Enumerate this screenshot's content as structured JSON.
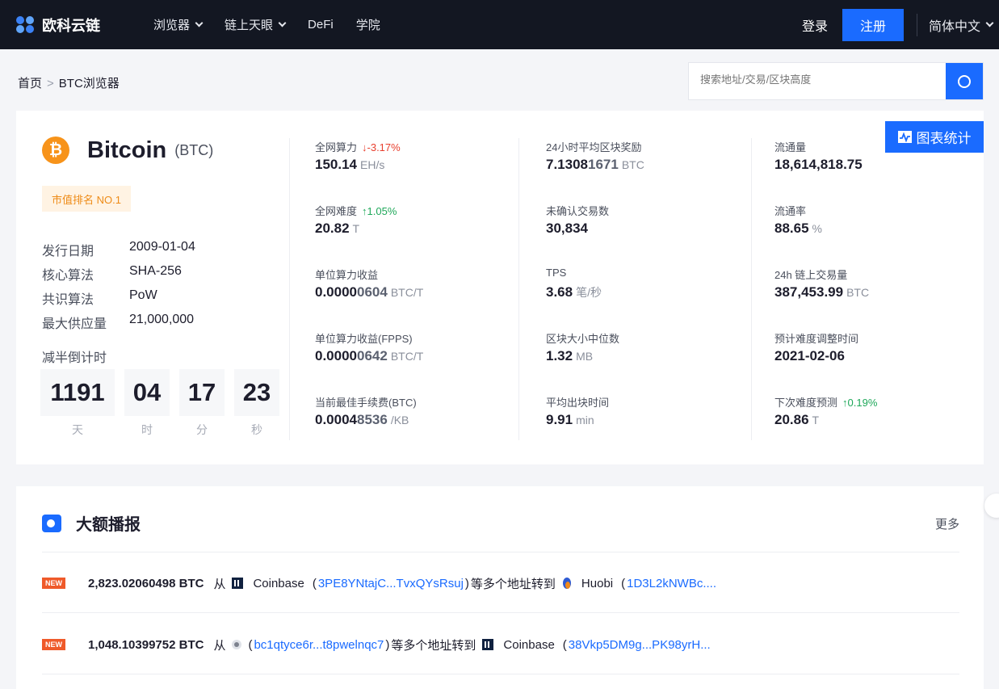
{
  "nav": {
    "logo": "欧科云链",
    "items": [
      {
        "label": "浏览器",
        "dropdown": true
      },
      {
        "label": "链上天眼",
        "dropdown": true
      },
      {
        "label": "DeFi",
        "dropdown": false
      },
      {
        "label": "学院",
        "dropdown": false
      }
    ],
    "login": "登录",
    "register": "注册",
    "language": "简体中文"
  },
  "breadcrumb": {
    "home": "首页",
    "sep": ">",
    "current": "BTC浏览器"
  },
  "search": {
    "placeholder": "搜索地址/交易/区块高度"
  },
  "coin": {
    "name": "Bitcoin",
    "symbol": "(BTC)",
    "rank": "市值排名 NO.1",
    "info": [
      {
        "label": "发行日期",
        "value": "2009-01-04"
      },
      {
        "label": "核心算法",
        "value": "SHA-256"
      },
      {
        "label": "共识算法",
        "value": "PoW"
      },
      {
        "label": "最大供应量",
        "value": "21,000,000"
      }
    ],
    "halving_label": "减半倒计时",
    "countdown": [
      {
        "value": "1191",
        "unit": "天"
      },
      {
        "value": "04",
        "unit": "时"
      },
      {
        "value": "17",
        "unit": "分"
      },
      {
        "value": "23",
        "unit": "秒"
      }
    ]
  },
  "chart_button": "图表统计",
  "stats": {
    "col1": [
      {
        "label": "全网算力",
        "change": "↓-3.17%",
        "dir": "down",
        "value_main": "150.14",
        "value_soft": "",
        "unit": "EH/s"
      },
      {
        "label": "全网难度",
        "change": "↑1.05%",
        "dir": "up",
        "value_main": "20.82",
        "value_soft": "",
        "unit": "T"
      },
      {
        "label": "单位算力收益",
        "change": "",
        "dir": "",
        "value_main": "0.0000",
        "value_soft": "0604",
        "unit": "BTC/T"
      },
      {
        "label": "单位算力收益(FPPS)",
        "change": "",
        "dir": "",
        "value_main": "0.0000",
        "value_soft": "0642",
        "unit": "BTC/T"
      },
      {
        "label": "当前最佳手续费(BTC)",
        "change": "",
        "dir": "",
        "value_main": "0.0004",
        "value_soft": "8536",
        "unit": "/KB"
      }
    ],
    "col2": [
      {
        "label": "24小时平均区块奖励",
        "change": "",
        "dir": "",
        "value_main": "7.1308",
        "value_soft": "1671",
        "unit": "BTC"
      },
      {
        "label": "未确认交易数",
        "change": "",
        "dir": "",
        "value_main": "30,834",
        "value_soft": "",
        "unit": ""
      },
      {
        "label": "TPS",
        "change": "",
        "dir": "",
        "value_main": "3.68",
        "value_soft": "",
        "unit": "笔/秒"
      },
      {
        "label": "区块大小中位数",
        "change": "",
        "dir": "",
        "value_main": "1.32",
        "value_soft": "",
        "unit": "MB"
      },
      {
        "label": "平均出块时间",
        "change": "",
        "dir": "",
        "value_main": "9.91",
        "value_soft": "",
        "unit": "min"
      }
    ],
    "col3": [
      {
        "label": "流通量",
        "change": "",
        "dir": "",
        "value_main": "18,614,818.75",
        "value_soft": "",
        "unit": ""
      },
      {
        "label": "流通率",
        "change": "",
        "dir": "",
        "value_main": "88.65",
        "value_soft": "",
        "unit": "%"
      },
      {
        "label": "24h 链上交易量",
        "change": "",
        "dir": "",
        "value_main": "387,453.99",
        "value_soft": "",
        "unit": "BTC"
      },
      {
        "label": "预计难度调整时间",
        "change": "",
        "dir": "",
        "value_main": "2021-02-06",
        "value_soft": "",
        "unit": ""
      },
      {
        "label": "下次难度预测",
        "change": "↑0.19%",
        "dir": "up",
        "value_main": "20.86",
        "value_soft": "",
        "unit": "T"
      }
    ]
  },
  "broadcast": {
    "title": "大额播报",
    "more": "更多",
    "items": [
      {
        "badge": "NEW",
        "amount": "2,823.02060498 BTC",
        "from_word": "从",
        "from_exchange": "Coinbase",
        "from_addr": "3PE8YNtajC...TvxQYsRsuj",
        "mid_text": "等多个地址转到",
        "to_exchange": "Huobi",
        "to_addr": "1D3L2kNWBc...."
      },
      {
        "badge": "NEW",
        "amount": "1,048.10399752 BTC",
        "from_word": "从",
        "from_exchange": "",
        "from_addr": "bc1qtyce6r...t8pwelnqc7",
        "mid_text": "等多个地址转到",
        "to_exchange": "Coinbase",
        "to_addr": "38Vkp5DM9g...PK98yrH..."
      }
    ]
  },
  "colors": {
    "accent": "#1a6bff",
    "nav_bg": "#131722",
    "btc": "#f7931a",
    "up": "#1fa85a",
    "down": "#e8402f"
  }
}
